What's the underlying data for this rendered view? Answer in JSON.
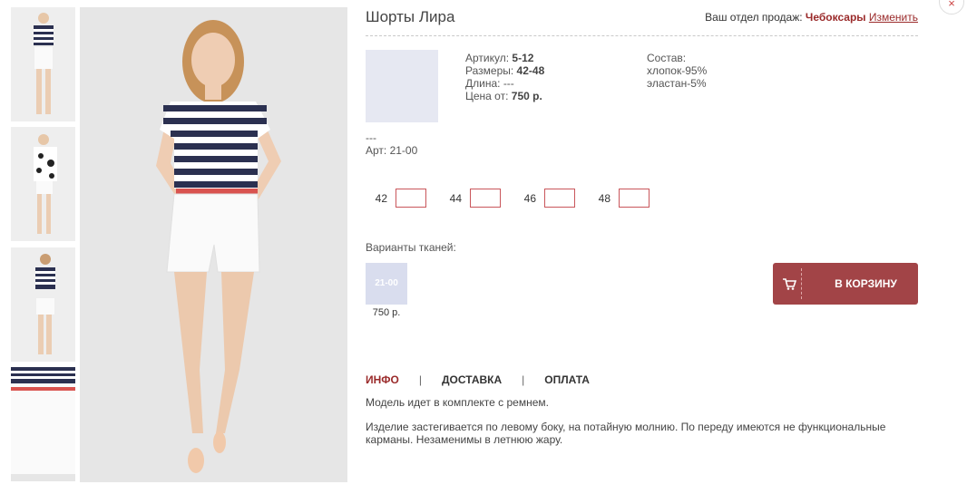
{
  "product": {
    "title": "Шорты Лира",
    "article_label": "Артикул:",
    "article": "5-12",
    "sizes_label": "Размеры:",
    "sizes": "42-48",
    "length_label": "Длина:",
    "length": "---",
    "price_label": "Цена от:",
    "price": "750 р.",
    "composition_label": "Состав:",
    "composition": [
      "хлопок-95%",
      "эластан-5%"
    ],
    "dashes": "---",
    "art_code": "Арт: 21-00"
  },
  "header": {
    "dept_label": "Ваш отдел продаж:",
    "city": "Чебоксары",
    "change_link": "Изменить",
    "close_glyph": "×"
  },
  "size_options": [
    {
      "label": "42",
      "value": ""
    },
    {
      "label": "44",
      "value": ""
    },
    {
      "label": "46",
      "value": ""
    },
    {
      "label": "48",
      "value": ""
    }
  ],
  "variants": {
    "label": "Варианты тканей:",
    "items": [
      {
        "code": "21-00",
        "price": "750 р.",
        "color": "#d9ddee"
      }
    ]
  },
  "cart": {
    "label": "В КОРЗИНУ",
    "icon": "cart-icon",
    "color": "#a24447"
  },
  "tabs": [
    {
      "label": "ИНФО",
      "active": true
    },
    {
      "label": "ДОСТАВКА",
      "active": false
    },
    {
      "label": "ОПЛАТА",
      "active": false
    }
  ],
  "tab_separator": "|",
  "description": [
    "Модель идет в комплекте с ремнем.",
    "Изделие застегивается по левому боку, на потайную молнию. По переду имеются не функциональные карманы. Незаменимы в летнюю жару."
  ],
  "colors": {
    "accent": "#9a2a2a",
    "button": "#a24447",
    "input_border": "#c9565b"
  }
}
